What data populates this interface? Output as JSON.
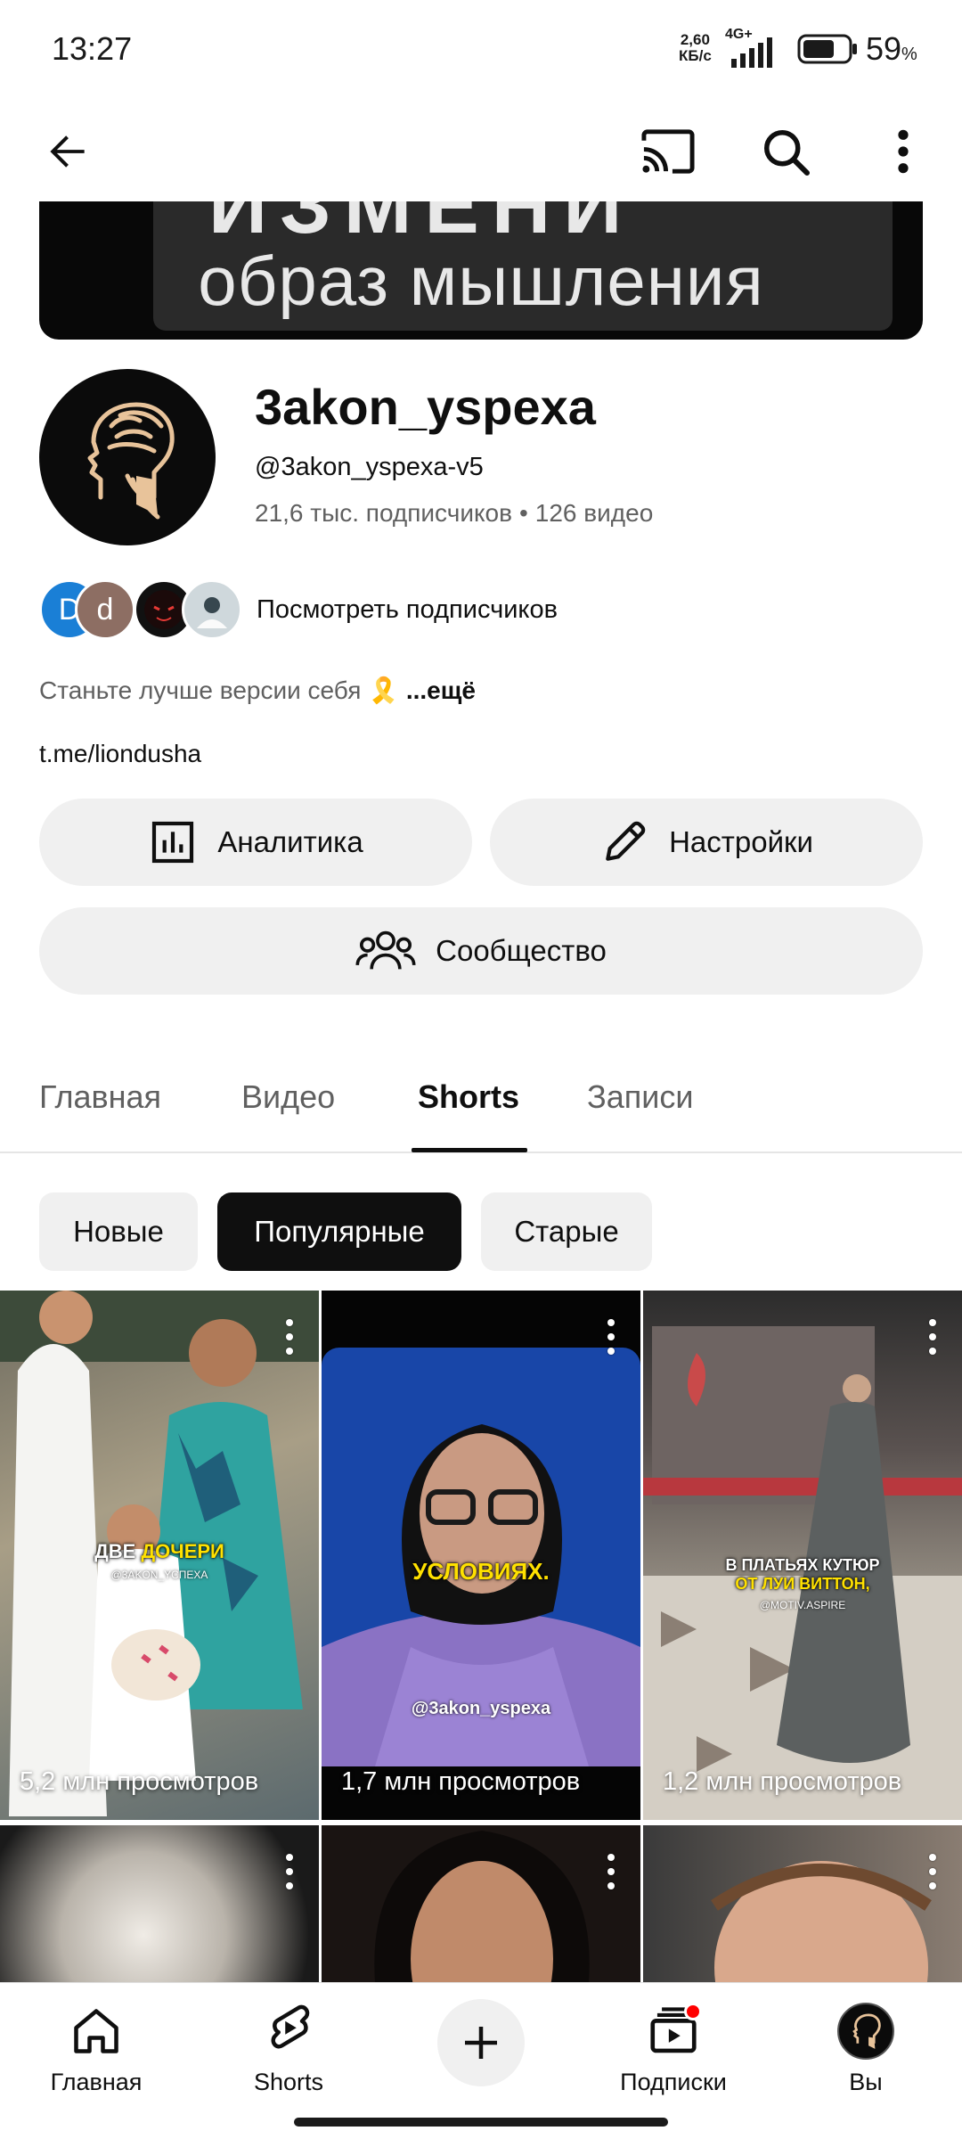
{
  "status": {
    "time": "13:27",
    "net_speed_line1": "2,60",
    "net_speed_line2": "КБ/с",
    "network": "4G+",
    "battery_pct": "59",
    "battery_unit": "%"
  },
  "banner": {
    "ghost_text": "ИЗМЕНИ",
    "text": "образ мышления"
  },
  "channel": {
    "name": "3akon_yspexa",
    "handle": "@3akon_yspexa-v5",
    "subscribers": "21,6 тыс. подписчиков",
    "separator": "•",
    "video_count": "126 видео",
    "sub_avatar_1": "D",
    "sub_avatar_2": "d",
    "view_subscribers": "Посмотреть подписчиков",
    "description": "Станьте лучше версии себя 🎗️",
    "description_more": "...ещё",
    "link": "t.me/liondusha"
  },
  "buttons": {
    "analytics": "Аналитика",
    "settings": "Настройки",
    "community": "Сообщество"
  },
  "tabs": [
    {
      "label": "Главная"
    },
    {
      "label": "Видео"
    },
    {
      "label": "Shorts"
    },
    {
      "label": "Записи"
    }
  ],
  "chips": [
    {
      "label": "Новые"
    },
    {
      "label": "Популярные"
    },
    {
      "label": "Старые"
    }
  ],
  "shorts": [
    {
      "views": "5,2 млн просмотров",
      "caption_white": "ДВЕ ",
      "caption_yellow": "ДОЧЕРИ",
      "watermark": "@3AKON_YCПEXA"
    },
    {
      "views": "1,7 млн просмотров",
      "caption_yellow": "УСЛОВИЯХ.",
      "watermark": "@3akon_yspexa"
    },
    {
      "views": "1,2 млн просмотров",
      "caption_white": "В ПЛАТЬЯХ КУТЮР",
      "caption_yellow": "ОТ ЛУИ ВИТТОН,",
      "watermark": "@MOTIV.ASPIRE"
    }
  ],
  "bottom_nav": {
    "home": "Главная",
    "shorts": "Shorts",
    "subscriptions": "Подписки",
    "you": "Вы"
  },
  "colors": {
    "accent_red": "#ff0000",
    "chip_active": "#0f0f0f",
    "pill_bg": "#f0f0f0",
    "secondary_text": "#606060"
  }
}
